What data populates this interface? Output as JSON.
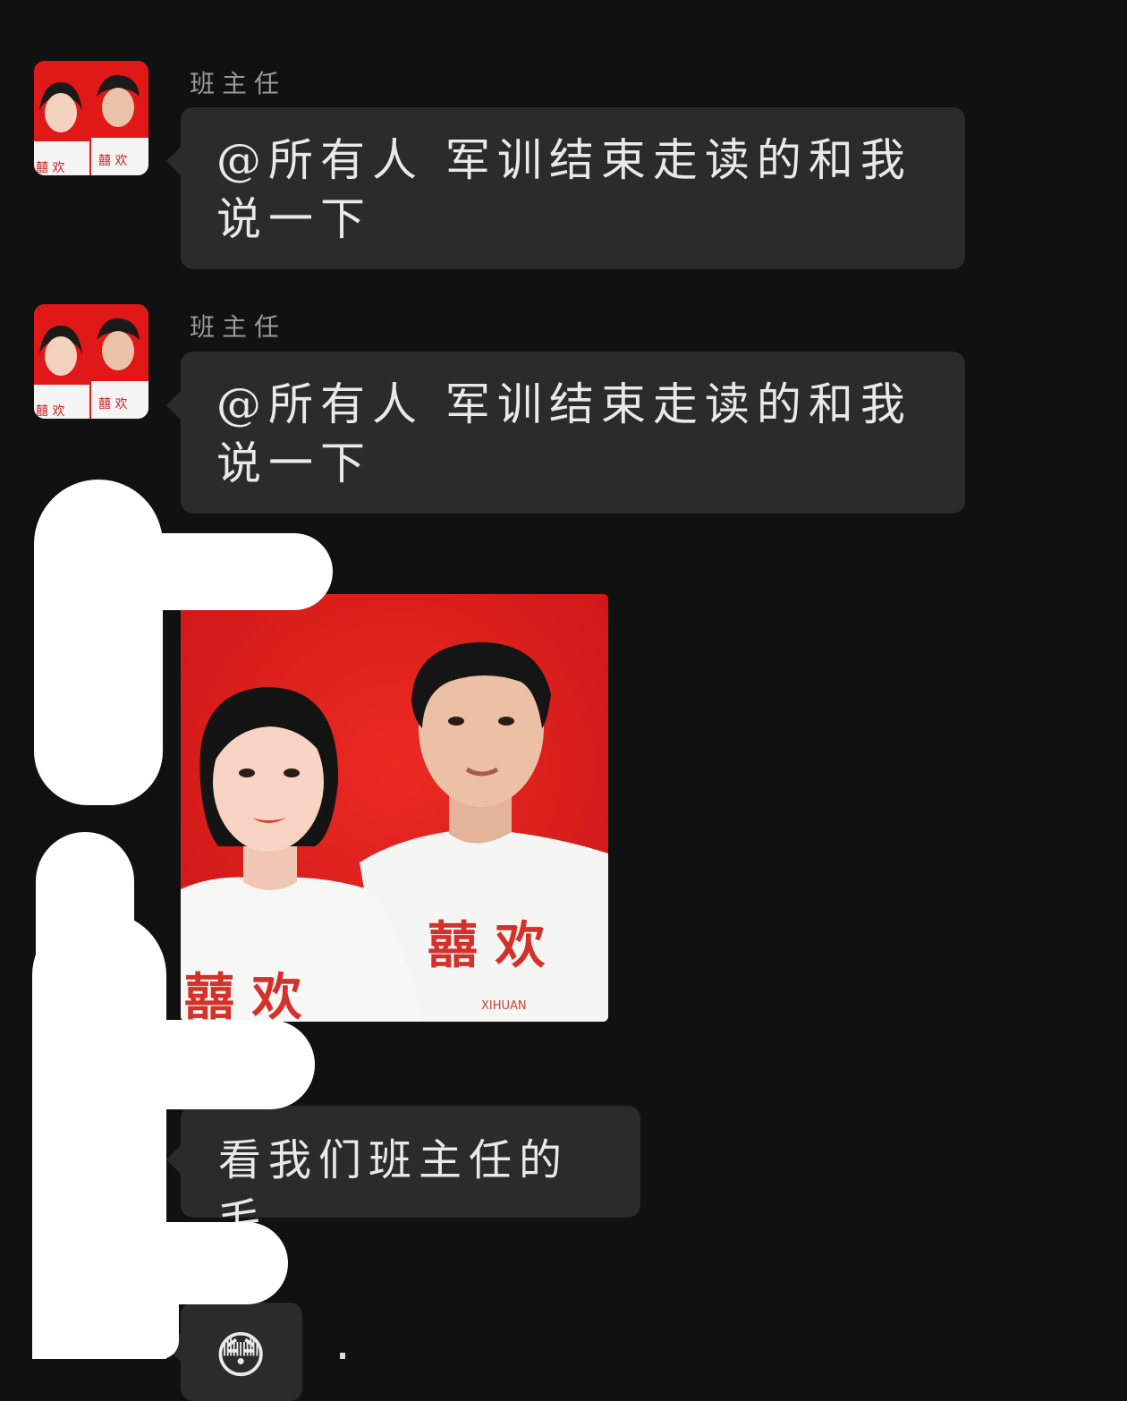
{
  "messages": [
    {
      "sender": "班主任",
      "text": "@所有人  军训结束走读的和我说一下"
    },
    {
      "sender": "班主任",
      "text": "@所有人  军训结束走读的和我说一下"
    },
    {
      "photo": {
        "shirt_text_left": "囍 欢",
        "shirt_text_right": "囍 欢",
        "shirt_caption": "XIHUAN"
      }
    },
    {
      "text": "看我们班主任的毛"
    },
    {
      "emoji": "😳"
    }
  ],
  "colors": {
    "background": "#111111",
    "bubble": "#2b2b2b",
    "text": "#e9e9e9",
    "sender": "#9a9a9a",
    "photo_red": "#dc1c1c",
    "redaction": "#ffffff"
  }
}
